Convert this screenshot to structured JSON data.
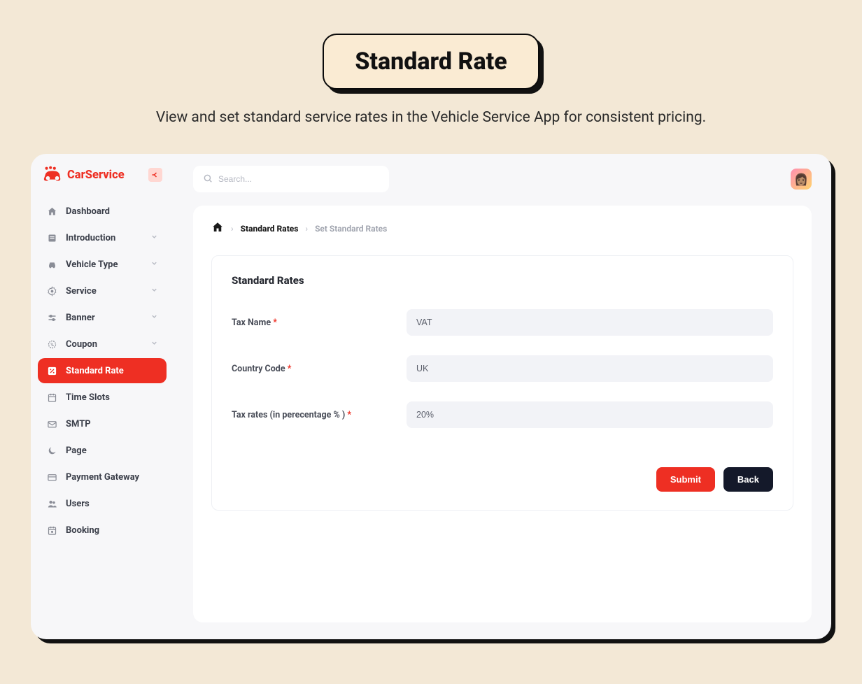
{
  "hero": {
    "title": "Standard Rate",
    "subtitle": "View and set standard service rates in the Vehicle Service App for consistent pricing."
  },
  "brand": {
    "name": "CarService"
  },
  "search": {
    "placeholder": "Search..."
  },
  "sidebar": {
    "items": [
      {
        "label": "Dashboard",
        "icon": "home",
        "expandable": false
      },
      {
        "label": "Introduction",
        "icon": "book",
        "expandable": true
      },
      {
        "label": "Vehicle Type",
        "icon": "car",
        "expandable": true
      },
      {
        "label": "Service",
        "icon": "gear",
        "expandable": true
      },
      {
        "label": "Banner",
        "icon": "sliders",
        "expandable": true
      },
      {
        "label": "Coupon",
        "icon": "ticket",
        "expandable": true
      },
      {
        "label": "Standard Rate",
        "icon": "percent",
        "expandable": false,
        "active": true
      },
      {
        "label": "Time Slots",
        "icon": "calendar",
        "expandable": false
      },
      {
        "label": "SMTP",
        "icon": "mail",
        "expandable": false
      },
      {
        "label": "Page",
        "icon": "moon",
        "expandable": false
      },
      {
        "label": "Payment Gateway",
        "icon": "card",
        "expandable": false
      },
      {
        "label": "Users",
        "icon": "users",
        "expandable": false
      },
      {
        "label": "Booking",
        "icon": "calendar2",
        "expandable": false
      }
    ]
  },
  "breadcrumb": {
    "level1": "Standard Rates",
    "level2": "Set Standard Rates"
  },
  "form": {
    "title": "Standard Rates",
    "fields": {
      "tax_name": {
        "label": "Tax Name",
        "value": "VAT"
      },
      "country_code": {
        "label": "Country Code",
        "value": "UK"
      },
      "tax_rate": {
        "label": "Tax rates (in perecentage % )",
        "value": "20%"
      }
    },
    "submit_label": "Submit",
    "back_label": "Back"
  }
}
